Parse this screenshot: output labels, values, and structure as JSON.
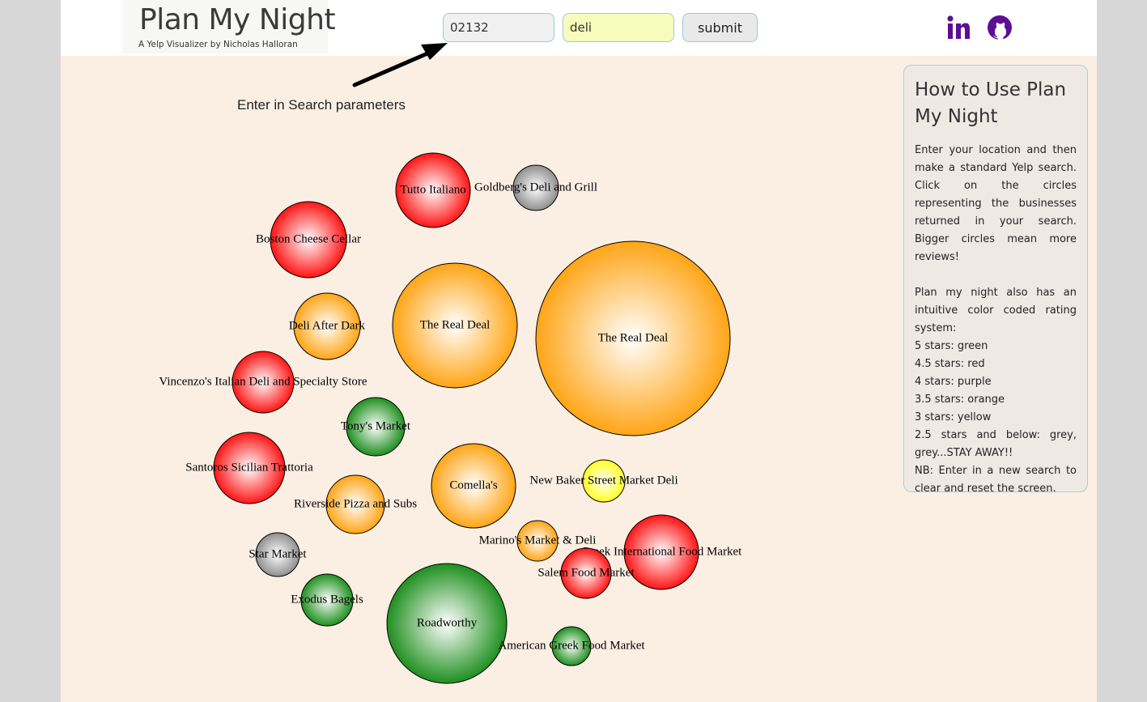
{
  "app": {
    "title": "Plan My Night",
    "subtitle": "A Yelp Visualizer by Nicholas Halloran"
  },
  "search": {
    "location_value": "02132",
    "term_value": "deli",
    "submit_label": "submit"
  },
  "social": {
    "linkedin_icon": "linkedin-icon",
    "github_icon": "github-icon",
    "icon_color": "#5b0f96"
  },
  "hint": {
    "text": "Enter in Search parameters"
  },
  "colors": {
    "5": "#1f8f1f",
    "4.5": "#ff1414",
    "4": "#7e2aa8",
    "3.5": "#ffa516",
    "3": "#ffff22",
    "2.5": "#8f8f8f"
  },
  "help": {
    "title": "How to Use Plan My Night",
    "para1": "Enter your location and then make a standard Yelp search. Click on the circles representing the businesses returned in your search. Bigger circles mean more reviews!",
    "para2": "Plan my night also has an intuitive color coded rating system:",
    "legend": [
      "5 stars: green",
      "4.5 stars: red",
      "4 stars: purple",
      "3.5 stars: orange",
      "3 stars: yellow",
      "2.5 stars and below: grey, grey...STAY AWAY!!"
    ],
    "note": "NB: Enter in a new search to clear and reset the screen."
  },
  "businesses": [
    {
      "name": "Tutto Italiano",
      "rating": 4.5
    },
    {
      "name": "Goldberg's Deli and Grill",
      "rating": 2.5
    },
    {
      "name": "Boston Cheese Cellar",
      "rating": 4.5
    },
    {
      "name": "The Real Deal",
      "rating": 3.5
    },
    {
      "name": "The Real Deal",
      "rating": 3.5
    },
    {
      "name": "Deli After Dark",
      "rating": 3.5
    },
    {
      "name": "Vincenzo's Italian Deli and Specialty Store",
      "rating": 4.5
    },
    {
      "name": "Tony's Market",
      "rating": 5
    },
    {
      "name": "Santoros Sicilian Trattoria",
      "rating": 4.5
    },
    {
      "name": "Comella's",
      "rating": 3.5
    },
    {
      "name": "New Baker Street Market Deli",
      "rating": 3
    },
    {
      "name": "Riverside Pizza and Subs",
      "rating": 3.5
    },
    {
      "name": "Star Market",
      "rating": 2.5
    },
    {
      "name": "Marino's Market & Deli",
      "rating": 3.5
    },
    {
      "name": "Greek International Food Market",
      "rating": 4.5
    },
    {
      "name": "Salem Food Market",
      "rating": 4.5
    },
    {
      "name": "Exodus Bagels",
      "rating": 5
    },
    {
      "name": "Roadworthy",
      "rating": 5
    },
    {
      "name": "American Greek Food Market",
      "rating": 5
    }
  ]
}
